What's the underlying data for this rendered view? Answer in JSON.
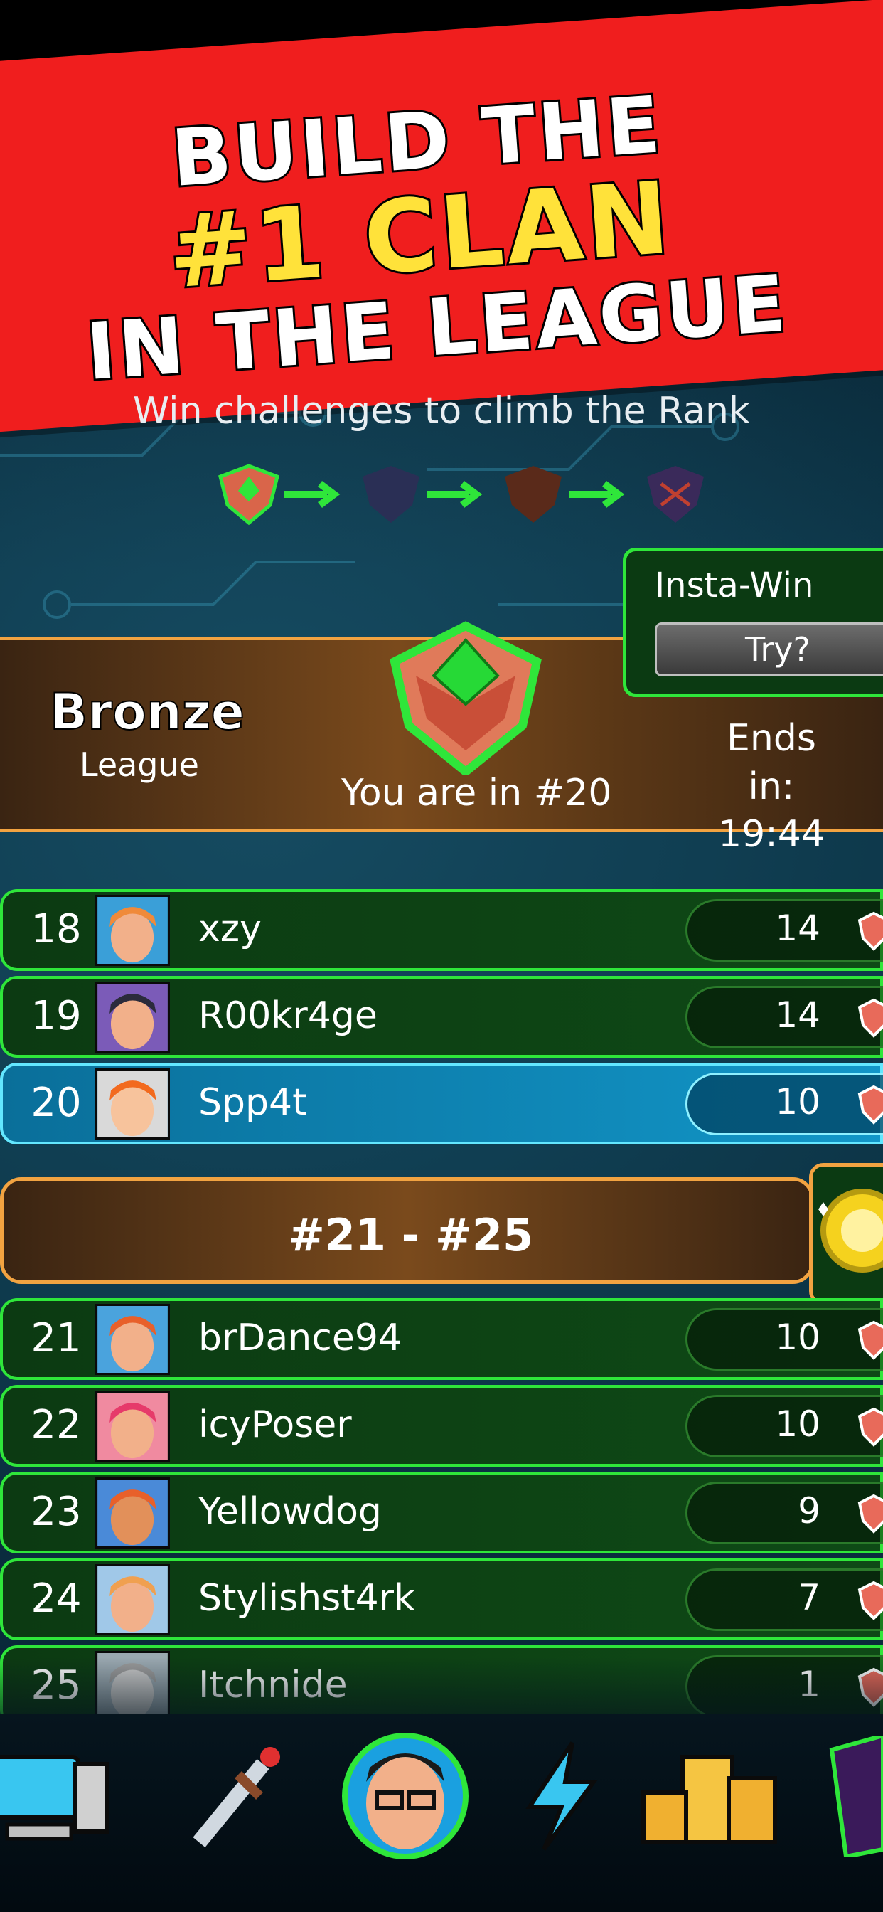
{
  "banner": {
    "line1": "BUILD THE",
    "line2": "#1 CLAN",
    "line3": "IN THE LEAGUE"
  },
  "subtitle": "Win challenges to climb the Rank",
  "rank_badges": [
    "bronze-badge-icon",
    "silver-badge-icon",
    "gold-badge-icon",
    "diamond-badge-icon"
  ],
  "insta_win": {
    "title": "Insta-Win",
    "button": "Try?"
  },
  "league": {
    "name": "Bronze",
    "sub": "League",
    "position": "You are in #20",
    "ends_label": "Ends in:",
    "ends_time": "19:44"
  },
  "rows_top": [
    {
      "rank": "18",
      "name": "xzy",
      "score": "14",
      "me": false,
      "avatar_color": "#f2b08a",
      "bg": "#3a9fd8",
      "hair": "#f08a3a"
    },
    {
      "rank": "19",
      "name": "R00kr4ge",
      "score": "14",
      "me": false,
      "avatar_color": "#f2b08a",
      "bg": "#7b5bb8",
      "hair": "#2b2b3b"
    },
    {
      "rank": "20",
      "name": "Spp4t",
      "score": "10",
      "me": true,
      "avatar_color": "#f7c39c",
      "bg": "#d9d9d9",
      "hair": "#f26a1e"
    }
  ],
  "range_label": "#21 - #25",
  "rows_bottom": [
    {
      "rank": "21",
      "name": "brDance94",
      "score": "10",
      "me": false,
      "avatar_color": "#f2b08a",
      "bg": "#4aa3dd",
      "hair": "#e8602a"
    },
    {
      "rank": "22",
      "name": "icyPoser",
      "score": "10",
      "me": false,
      "avatar_color": "#f2b08a",
      "bg": "#f08aa0",
      "hair": "#e63a6a"
    },
    {
      "rank": "23",
      "name": "Yellowdog",
      "score": "9",
      "me": false,
      "avatar_color": "#e2905a",
      "bg": "#4a8ad8",
      "hair": "#e8602a"
    },
    {
      "rank": "24",
      "name": "Stylishst4rk",
      "score": "7",
      "me": false,
      "avatar_color": "#f2b08a",
      "bg": "#a0c8e8",
      "hair": "#f0a050"
    },
    {
      "rank": "25",
      "name": "Itchnide",
      "score": "1",
      "me": false,
      "avatar_color": "#c8c8c8",
      "bg": "#9aa8b0",
      "hair": "#9a9a9a"
    }
  ],
  "nav": [
    "computer-icon",
    "sword-icon",
    "profile-avatar-icon",
    "lightning-icon",
    "podium-icon",
    "card-icon"
  ],
  "colors": {
    "accent_green": "#2fe63a",
    "banner_red": "#f01e1e",
    "headline_yellow": "#ffe23a",
    "bronze": "#f2a341",
    "highlight_blue": "#1296c8"
  }
}
